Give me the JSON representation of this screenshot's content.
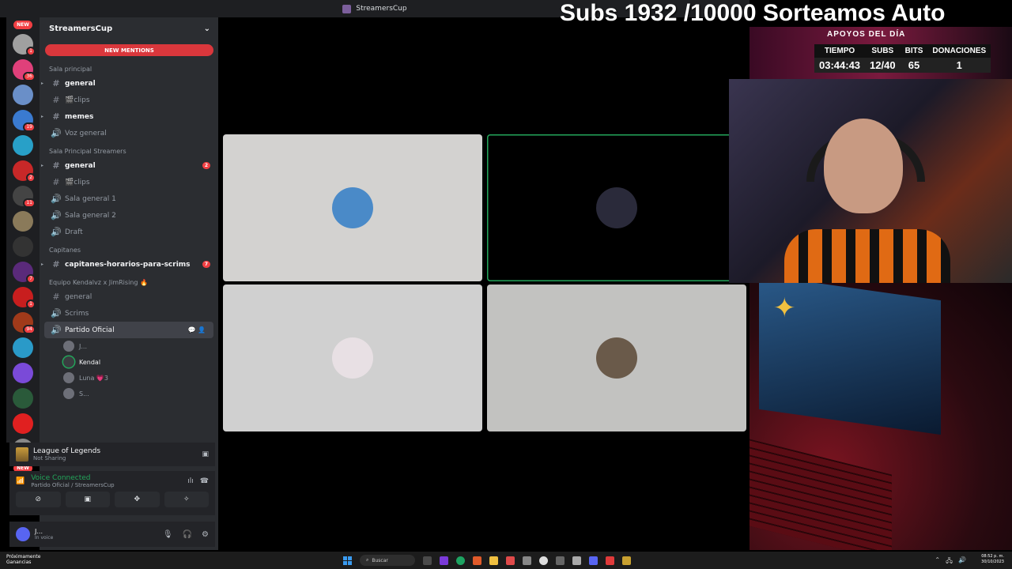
{
  "window": {
    "title": "StreamersCup"
  },
  "servers": [
    {
      "color": "#f23f43",
      "new": true
    },
    {
      "color": "#a0a0a0",
      "badge": "1"
    },
    {
      "color": "#e0407a",
      "badge": "36"
    },
    {
      "color": "#6a8fc8",
      "badge": ""
    },
    {
      "color": "#3a7ad0",
      "badge": "19"
    },
    {
      "color": "#28a0c8",
      "badge": ""
    },
    {
      "color": "#c82828",
      "badge": "2"
    },
    {
      "color": "#444",
      "badge": "11"
    },
    {
      "color": "#8a7a5a",
      "badge": ""
    },
    {
      "color": "#333",
      "badge": ""
    },
    {
      "color": "#5a2a7a",
      "badge": "7"
    },
    {
      "color": "#c81e1e",
      "badge": "1"
    },
    {
      "color": "#a03a1a",
      "badge": "94"
    },
    {
      "color": "#2a9ac8",
      "badge": ""
    },
    {
      "color": "#7a4ad8",
      "badge": ""
    },
    {
      "color": "#2a5a3a",
      "badge": ""
    },
    {
      "color": "#e02020",
      "badge": ""
    },
    {
      "color": "#888",
      "badge": ""
    },
    {
      "color": "#f23f43",
      "new": true
    }
  ],
  "new_label": "NEW",
  "guild": {
    "name": "StreamersCup",
    "new_mentions": "NEW MENTIONS"
  },
  "categories": {
    "sala_principal": "Sala principal",
    "sala_streamers": "Sala Principal Streamers",
    "capitanes": "Capitanes",
    "equipo": "Equipo Kendalvz x JimRising 🔥"
  },
  "channels": {
    "general1": "general",
    "clips1": "🎬clips",
    "memes": "memes",
    "voz_general": "Voz general",
    "general2": "general",
    "general2_count": "2",
    "clips2": "🎬clips",
    "sala1": "Sala general 1",
    "sala2": "Sala general 2",
    "draft": "Draft",
    "capitanes": "capitanes-horarios-para-scrims",
    "capitanes_count": "7",
    "general3": "general",
    "scrims": "Scrims",
    "partido": "Partido Oficial"
  },
  "voice_users": [
    {
      "name": "J...",
      "speaking": false
    },
    {
      "name": "Kendal",
      "speaking": true
    },
    {
      "name": "Luna 💗3",
      "speaking": false
    },
    {
      "name": "S...",
      "speaking": false
    }
  ],
  "activity": {
    "game": "League of Legends",
    "status": "Not Sharing"
  },
  "voice": {
    "status": "Voice Connected",
    "location": "Partido Oficial / StreamersCup"
  },
  "user": {
    "name": "J...",
    "status": "In voice"
  },
  "tiles": [
    {
      "bg": "#d3d2d0",
      "avatar": "#4a8ac8",
      "speaking": false
    },
    {
      "bg": "#000000",
      "avatar": "#2a2a3a",
      "speaking": true
    },
    {
      "bg": "#d0d0d0",
      "avatar": "#e8e0e4",
      "speaking": false
    },
    {
      "bg": "#c2c2c0",
      "avatar": "#6a5a4a",
      "speaking": false
    }
  ],
  "overlay": {
    "subs_goal": "Subs 1932 /10000 Sorteamos Auto",
    "apoyos_title": "APOYOS DEL DÍA",
    "headers": [
      "TIEMPO",
      "SUBS",
      "BITS",
      "DONACIONES"
    ],
    "values": [
      "03:44:43",
      "12/40",
      "65",
      "1"
    ]
  },
  "taskbar": {
    "weather_line1": "Próximamente",
    "weather_line2": "Ganancias",
    "search": "Buscar",
    "time": "08:52 p. m.",
    "date": "30/10/2023"
  }
}
